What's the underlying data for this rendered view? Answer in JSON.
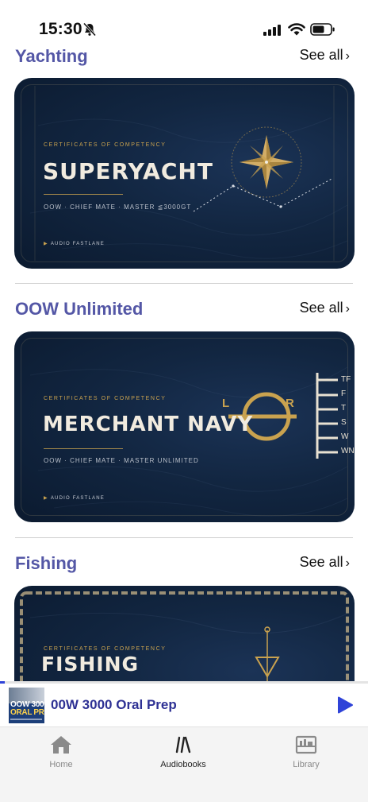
{
  "status_bar": {
    "time": "15:30"
  },
  "sections": [
    {
      "title": "Yachting",
      "see_all": "See all",
      "cover": {
        "kicker": "CERTIFICATES OF COMPETENCY",
        "title": "SUPERYACHT",
        "subtitle": "OOW · CHIEF MATE · MASTER ≦3000GT",
        "brand": "AUDIO FASTLANE"
      }
    },
    {
      "title": "OOW Unlimited",
      "see_all": "See all",
      "cover": {
        "kicker": "CERTIFICATES OF COMPETENCY",
        "title": "MERCHANT NAVY",
        "subtitle": "OOW · CHIEF MATE · MASTER UNLIMITED",
        "brand": "AUDIO FASTLANE",
        "lr_left": "L",
        "lr_right": "R",
        "load_lines": [
          "TF",
          "F",
          "T",
          "S",
          "W",
          "WN"
        ]
      }
    },
    {
      "title": "Fishing",
      "see_all": "See all",
      "cover": {
        "kicker": "CERTIFICATES OF COMPETENCY",
        "title": "FISHING"
      }
    }
  ],
  "mini_player": {
    "title": "00W 3000 Oral Prep",
    "art_line_1": "OOW 3000",
    "art_line_2": "ORAL PREP",
    "progress": 0.013
  },
  "tab_bar": {
    "tabs": [
      {
        "label": "Home",
        "icon": "home-icon",
        "active": false
      },
      {
        "label": "Audiobooks",
        "icon": "audiobooks-icon",
        "active": true
      },
      {
        "label": "Library",
        "icon": "library-icon",
        "active": false
      }
    ]
  },
  "colors": {
    "accent": "#5457a6",
    "player_title": "#2e3194",
    "play": "#2f43d8",
    "cover_bg": "#122641",
    "gold": "#c9a24f"
  }
}
